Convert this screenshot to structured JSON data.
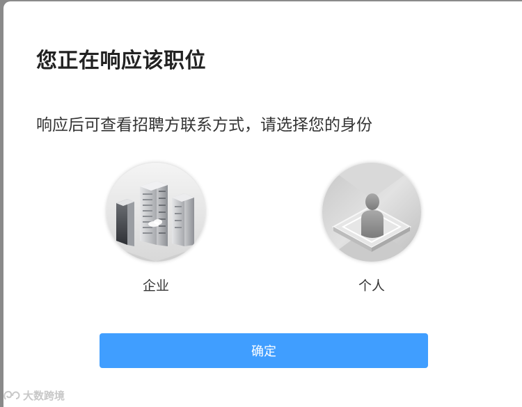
{
  "dialog": {
    "title": "您正在响应该职位",
    "subtitle": "响应后可查看招聘方联系方式，请选择您的身份"
  },
  "options": [
    {
      "label": "企业",
      "icon": "building-icon"
    },
    {
      "label": "个人",
      "icon": "person-icon"
    }
  ],
  "confirm_label": "确定",
  "watermark_text": "大数跨境",
  "colors": {
    "primary": "#409eff",
    "title": "#222222",
    "text": "#333333",
    "backdrop": "#8a8a8a"
  }
}
